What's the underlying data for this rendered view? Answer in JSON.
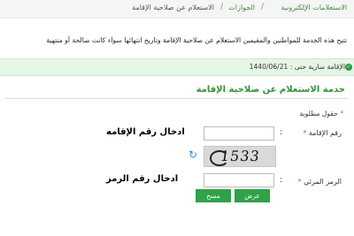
{
  "breadcrumb": {
    "root": "الاستعلامات الإلكترونية",
    "middle": "الجوازات",
    "current": "الاستعلام عن صلاحية الإقامة"
  },
  "description": "تتيح هذه الخدمة للمواطنين والمقيمين الاستعلام عن صلاحية الإقامة وتاريخ انتهائها سواء كانت صالحة أو منتهية",
  "notice": {
    "text": "الإقامة سارية حتى : 1440/06/21",
    "color": "#e6f6e6"
  },
  "service": {
    "title": "خدمة الاستعلام عن صلاحية الإقامة",
    "required_note": "حقول مطلوبة",
    "iqama_label": "رقم الإقامة",
    "iqama_value": "",
    "iqama_annotation": "ادخال رقم الإقامه",
    "captcha_text": "1533",
    "captcha_label": "الرمز المرئي",
    "captcha_value": "",
    "captcha_annotation": "ادخال رقم الرمز",
    "search_button": "عرض",
    "clear_button": "مسح",
    "button_color": "#2fa24a",
    "accent_color": "#3a8f3a"
  },
  "icons": {
    "refresh": "refresh-icon",
    "check": "check-circle-icon"
  }
}
